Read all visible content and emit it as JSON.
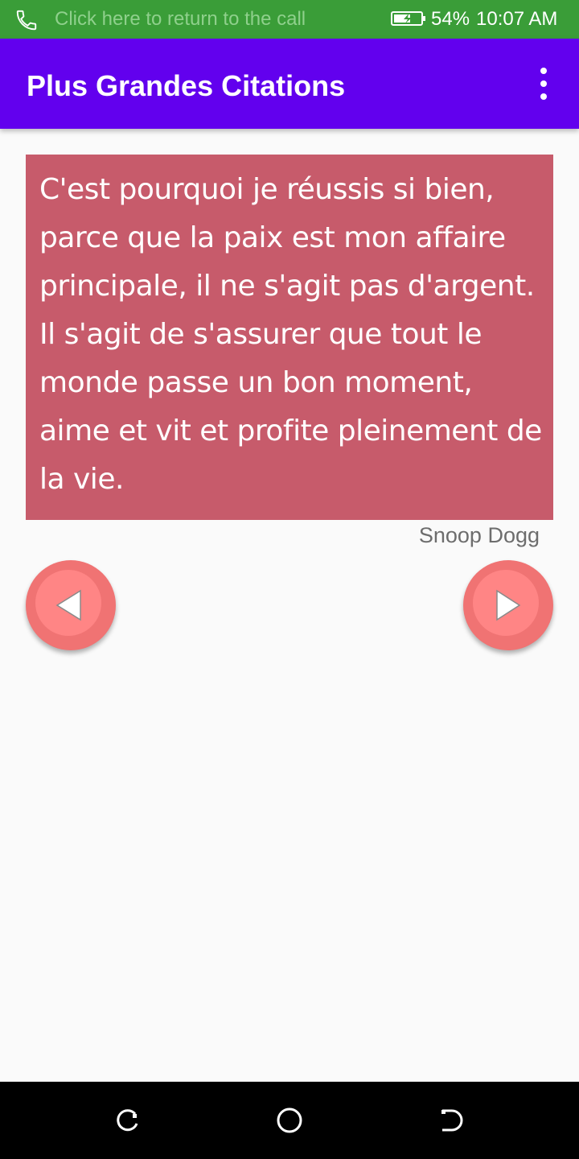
{
  "status_bar": {
    "call_text": "Click here to return to the call",
    "battery_percent": "54%",
    "time": "10:07 AM",
    "battery_level": 0.54,
    "icons": [
      "phone-icon",
      "battery-charging-icon"
    ]
  },
  "app_bar": {
    "title": "Plus Grandes Citations",
    "menu_icon": "more-vert-icon"
  },
  "quote": {
    "text": "C'est pourquoi je réussis si bien, parce que la paix est mon affaire principale, il ne s'agit pas d'argent. Il s'agit de s'assurer que tout le monde passe un bon moment, aime et vit et profite pleinement de la vie.",
    "author": "Snoop Dogg"
  },
  "navigation": {
    "prev_icon": "play-left-icon",
    "next_icon": "play-right-icon"
  },
  "system_nav": {
    "icons": [
      "recent-apps-icon",
      "home-icon",
      "back-icon"
    ]
  },
  "colors": {
    "status_bar": "#3a9d38",
    "app_bar": "#6200ee",
    "quote_card": "#c75b6b",
    "nav_button": "#f07373",
    "background": "#fafafa"
  }
}
